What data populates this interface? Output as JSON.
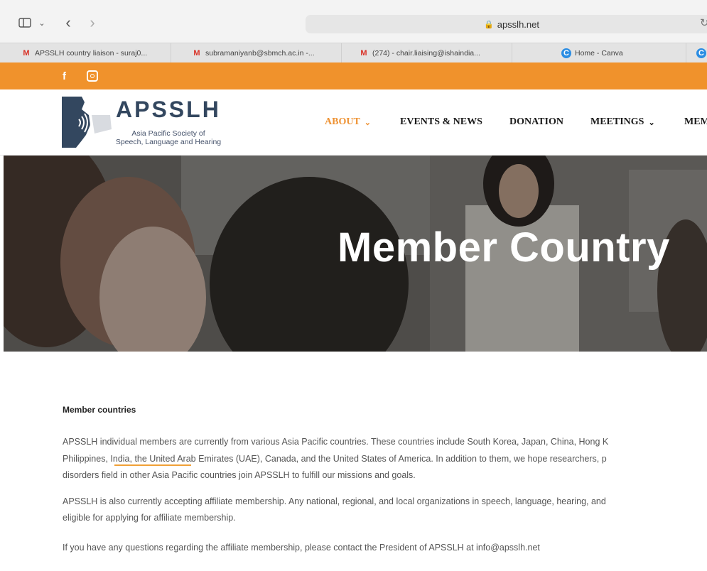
{
  "browser": {
    "url": "apsslh.net",
    "tabs": [
      {
        "title": "APSSLH country liaison - suraj0...",
        "icon": "gmail-icon"
      },
      {
        "title": "subramaniyanb@sbmch.ac.in -...",
        "icon": "gmail-icon"
      },
      {
        "title": "(274) - chair.liaising@ishaindia...",
        "icon": "gmail-icon"
      },
      {
        "title": "Home - Canva",
        "icon": "canva-icon"
      }
    ]
  },
  "social": {
    "facebook": "f",
    "instagram": "instagram-icon"
  },
  "logo": {
    "title": "APSSLH",
    "subtitle_line1": "Asia Pacific Society of",
    "subtitle_line2": "Speech, Language and Hearing"
  },
  "nav": {
    "items": [
      {
        "label": "ABOUT",
        "has_dropdown": true,
        "active": true
      },
      {
        "label": "EVENTS & NEWS",
        "has_dropdown": false
      },
      {
        "label": "DONATION",
        "has_dropdown": false
      },
      {
        "label": "MEETINGS",
        "has_dropdown": true
      },
      {
        "label": "MEM",
        "has_dropdown": false
      }
    ],
    "active_color": "#ee9233"
  },
  "hero": {
    "title": "Member Country"
  },
  "content": {
    "heading": "Member countries",
    "p1_line1": "APSSLH individual members are currently from various Asia Pacific countries. These countries include South Korea, Japan, China, Hong K",
    "p1_line2": "Philippines, India, the United Arab Emirates (UAE), Canada, and the United States of America. In addition to them, we hope researchers, p",
    "p1_line3": "disorders field in other Asia Pacific countries join APSSLH to fulfill our missions and goals.",
    "p2_line1": "APSSLH is also currently accepting affiliate membership. Any national, regional, and local organizations in speech, language, hearing, and",
    "p2_line2": "eligible for applying for affiliate membership.",
    "p3": "If you have any questions regarding the affiliate membership, please contact the President of APSSLH at info@apsslh.net"
  },
  "colors": {
    "orange_bar": "#f0922c",
    "underline": "#f0a037"
  }
}
